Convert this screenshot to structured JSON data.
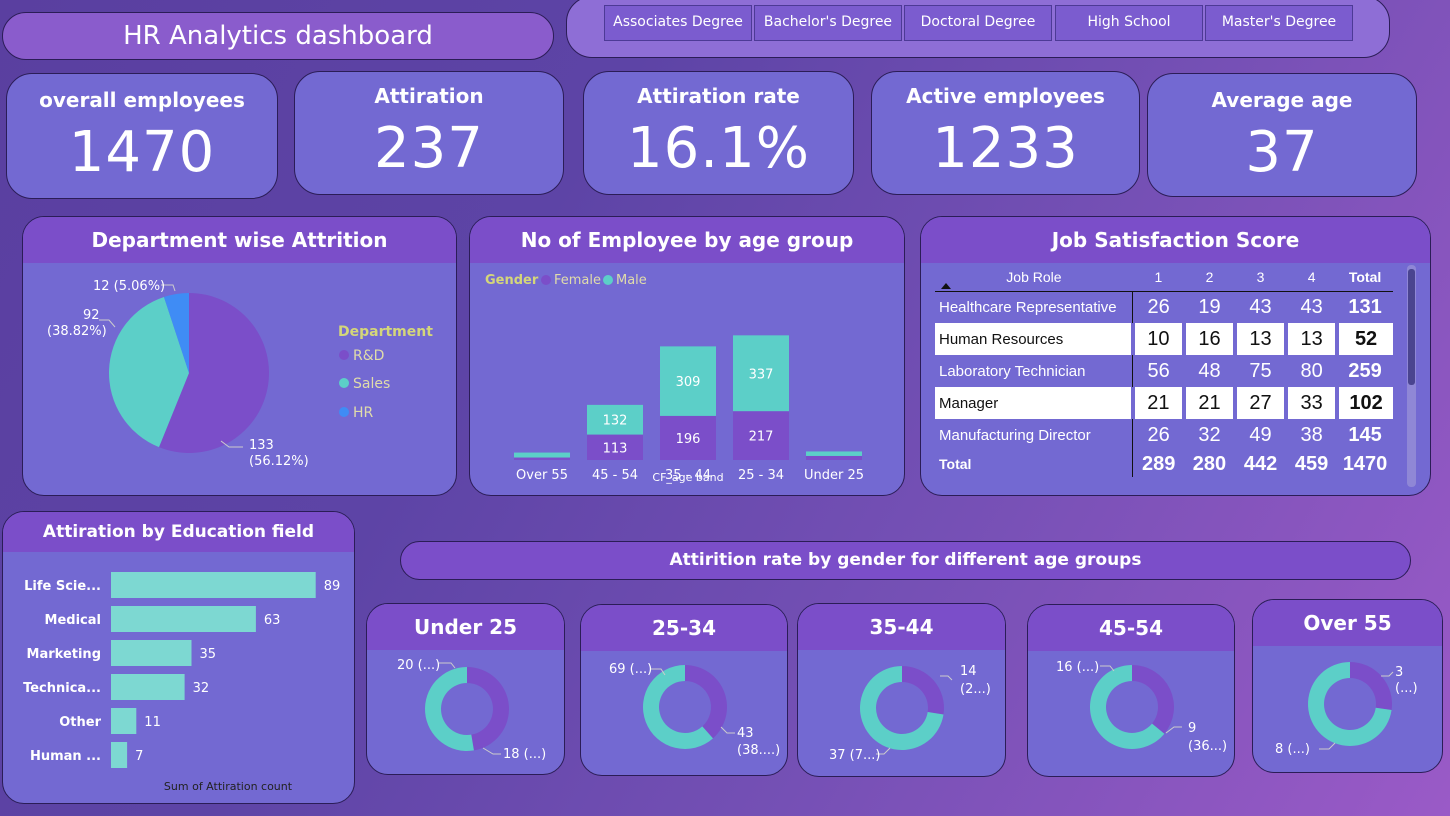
{
  "title": "HR Analytics dashboard",
  "education_slicer": [
    "Associates Degree",
    "Bachelor's Degree",
    "Doctoral Degree",
    "High School",
    "Master's Degree"
  ],
  "kpis": {
    "overall": {
      "label": "overall employees",
      "value": "1470"
    },
    "attrition": {
      "label": "Attiration",
      "value": "237"
    },
    "rate": {
      "label": "Attiration rate",
      "value": "16.1%"
    },
    "active": {
      "label": "Active employees",
      "value": "1233"
    },
    "age": {
      "label": "Average age",
      "value": "37"
    }
  },
  "dept": {
    "title": "Department wise Attrition",
    "legend_title": "Department",
    "legend": [
      "R&D",
      "Sales",
      "HR"
    ],
    "labels": {
      "hr": "12 (5.06%)",
      "sales_a": "92",
      "sales_b": "(38.82%)",
      "rd_a": "133",
      "rd_b": "(56.12%)"
    },
    "colors": {
      "rd": "#7b4ec9",
      "sales": "#5ccfc8",
      "hr": "#3f8cf5"
    }
  },
  "age_chart": {
    "title": "No of Employee by age group",
    "legend_title": "Gender",
    "legend": [
      "Female",
      "Male"
    ],
    "xlabel": "CF_age band"
  },
  "jobsat": {
    "title": "Job Satisfaction Score",
    "headers": [
      "Job Role",
      "1",
      "2",
      "3",
      "4",
      "Total"
    ],
    "rows": [
      [
        "Healthcare Representative",
        "26",
        "19",
        "43",
        "43",
        "131"
      ],
      [
        "Human Resources",
        "10",
        "16",
        "13",
        "13",
        "52"
      ],
      [
        "Laboratory Technician",
        "56",
        "48",
        "75",
        "80",
        "259"
      ],
      [
        "Manager",
        "21",
        "21",
        "27",
        "33",
        "102"
      ],
      [
        "Manufacturing Director",
        "26",
        "32",
        "49",
        "38",
        "145"
      ]
    ],
    "total": [
      "Total",
      "289",
      "280",
      "442",
      "459",
      "1470"
    ]
  },
  "edu": {
    "title": "Attiration by Education field",
    "xlabel": "Sum of Attiration count"
  },
  "gender_banner": "Attirition rate by gender for different age groups",
  "donuts": [
    {
      "title": "Under 25",
      "l1": "20 (...)",
      "l2": "18 (...)",
      "female": 18,
      "male": 20
    },
    {
      "title": "25-34",
      "l1": "69 (...)",
      "l2a": "43",
      "l2b": "(38....)",
      "female": 43,
      "male": 69
    },
    {
      "title": "35-44",
      "l1a": "14",
      "l1b": "(2...)",
      "l2": "37 (7...)",
      "female": 14,
      "male": 37
    },
    {
      "title": "45-54",
      "l1": "16 (...)",
      "l2a": "9",
      "l2b": "(36...)",
      "female": 9,
      "male": 16
    },
    {
      "title": "Over 55",
      "l1a": "3",
      "l1b": "(...)",
      "l2": "8 (...)",
      "female": 3,
      "male": 8
    }
  ],
  "chart_data": [
    {
      "type": "pie",
      "title": "Department wise Attrition",
      "categories": [
        "R&D",
        "Sales",
        "HR"
      ],
      "values": [
        133,
        92,
        12
      ],
      "percent": [
        56.12,
        38.82,
        5.06
      ]
    },
    {
      "type": "bar",
      "title": "No of Employee by age group",
      "xlabel": "CF_age band",
      "categories": [
        "Over 55",
        "45 - 54",
        "35 - 44",
        "25 - 34",
        "Under 25"
      ],
      "series": [
        {
          "name": "Female",
          "values": [
            11,
            113,
            196,
            217,
            18
          ]
        },
        {
          "name": "Male",
          "values": [
            22,
            132,
            309,
            337,
            20
          ]
        }
      ]
    },
    {
      "type": "bar",
      "title": "Attiration by Education field",
      "xlabel": "Sum of Attiration count",
      "categories": [
        "Life Scie...",
        "Medical",
        "Marketing",
        "Technica...",
        "Other",
        "Human ..."
      ],
      "values": [
        89,
        63,
        35,
        32,
        11,
        7
      ]
    }
  ]
}
